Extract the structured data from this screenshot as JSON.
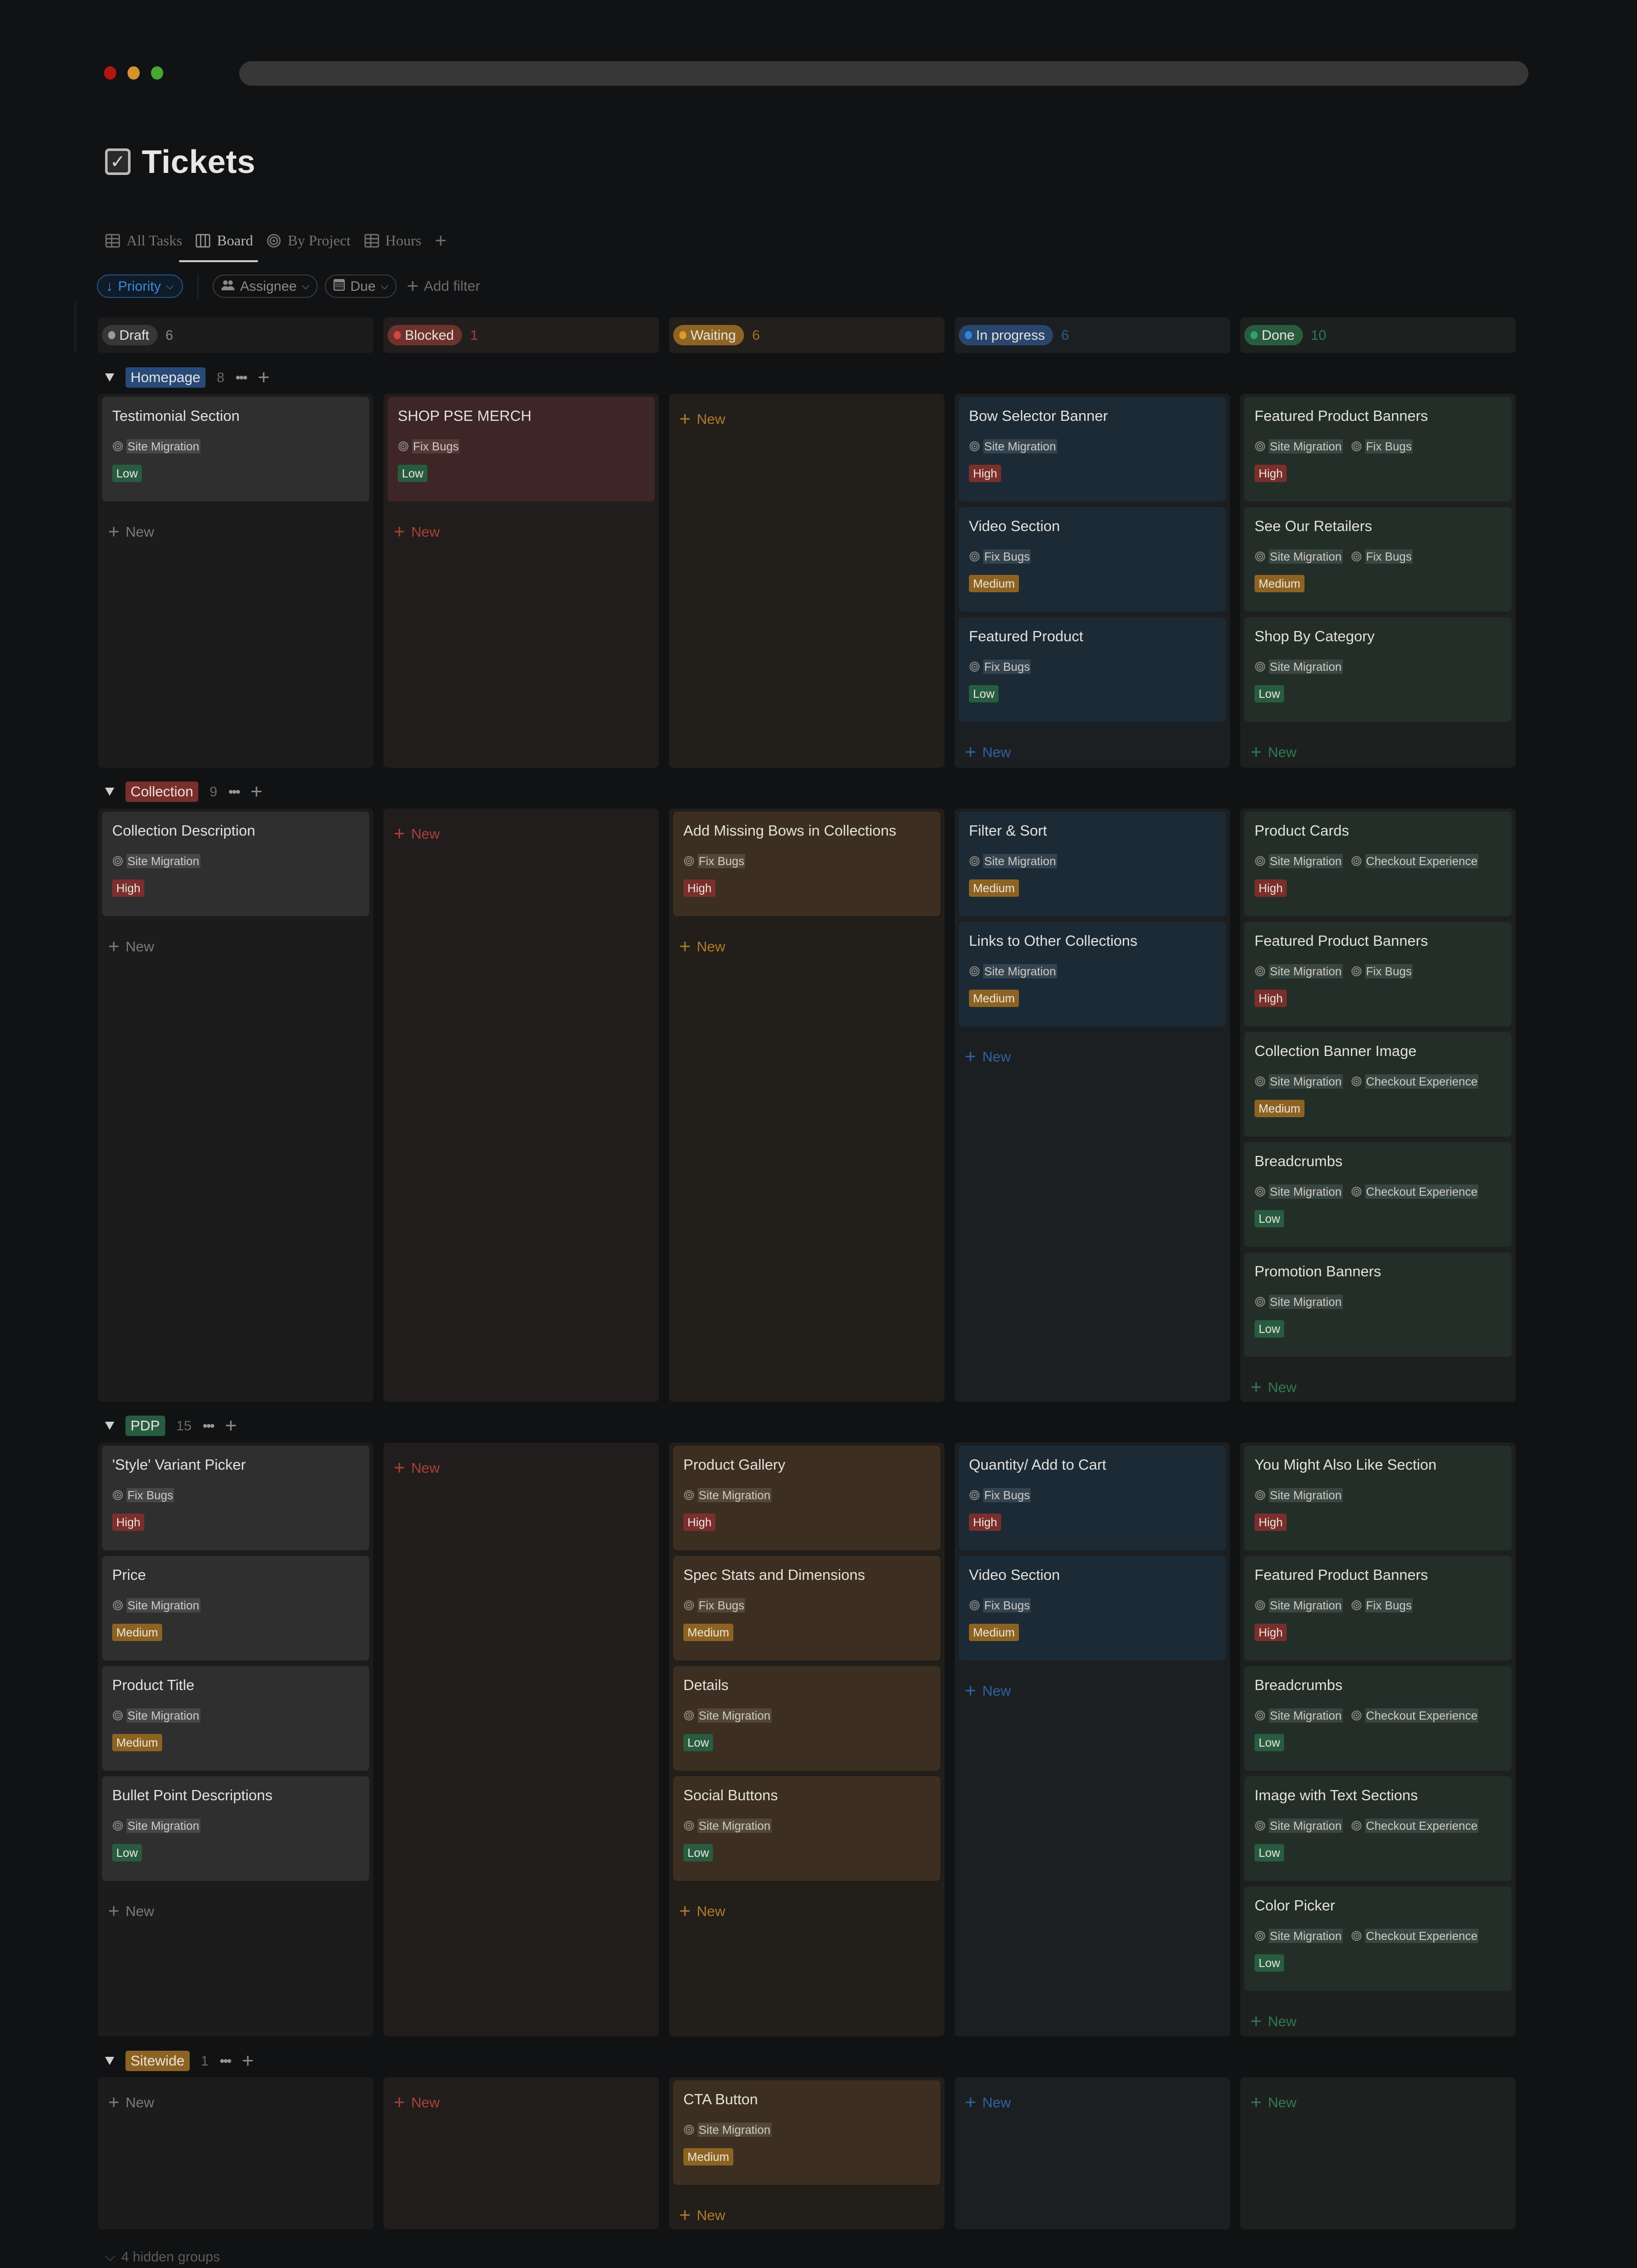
{
  "window": {
    "traffic_lights": [
      {
        "name": "close",
        "color": "#b3160f"
      },
      {
        "name": "minimize",
        "color": "#d5922f"
      },
      {
        "name": "maximize",
        "color": "#46a733"
      }
    ]
  },
  "page": {
    "title": "Tickets",
    "icon": "checkbox-icon"
  },
  "tabs": [
    {
      "label": "All Tasks",
      "icon": "table-icon",
      "active": false
    },
    {
      "label": "Board",
      "icon": "board-icon",
      "active": true
    },
    {
      "label": "By Project",
      "icon": "target-icon",
      "active": false
    },
    {
      "label": "Hours",
      "icon": "table-icon",
      "active": false
    }
  ],
  "tab_add_label": "+",
  "filters": {
    "sort": {
      "label": "Priority",
      "icon": "arrow-down-icon",
      "color": "#3b8ae0"
    },
    "assignee": {
      "label": "Assignee",
      "icon": "people-icon"
    },
    "due": {
      "label": "Due",
      "icon": "calendar-icon"
    },
    "add_filter_label": "Add filter"
  },
  "statuses": [
    {
      "key": "draft",
      "label": "Draft",
      "count": "6",
      "dot": "#9b9a97",
      "pill_bg": "#373737",
      "head_bg": "#1c1c1d",
      "lane_bg": "#1c1c1d",
      "card_bg": "#2f2f2f",
      "count_color": "#8a8884",
      "new_color": "#7d7a75",
      "tag_bg": "#474747"
    },
    {
      "key": "blocked",
      "label": "Blocked",
      "count": "1",
      "dot": "#d4463f",
      "pill_bg": "#6e322d",
      "head_bg": "#231e1e",
      "lane_bg": "#221d1d",
      "card_bg": "#3d2625",
      "count_color": "#a8403a",
      "new_color": "#a8403a",
      "tag_bg": "#553a38"
    },
    {
      "key": "waiting",
      "label": "Waiting",
      "count": "6",
      "dot": "#d99c26",
      "pill_bg": "#8e6423",
      "head_bg": "#221f1c",
      "lane_bg": "#221e1a",
      "card_bg": "#3c2f21",
      "count_color": "#a0722a",
      "new_color": "#b07c2a",
      "tag_bg": "#54473a"
    },
    {
      "key": "in_progress",
      "label": "In progress",
      "count": "6",
      "dot": "#2d84e0",
      "pill_bg": "#28466e",
      "head_bg": "#1c1f22",
      "lane_bg": "#1b1f22",
      "card_bg": "#1c2a36",
      "count_color": "#2f5a8e",
      "new_color": "#2f63a0",
      "tag_bg": "#334350"
    },
    {
      "key": "done",
      "label": "Done",
      "count": "10",
      "dot": "#2fa36a",
      "pill_bg": "#2a5b3f",
      "head_bg": "#1c201e",
      "lane_bg": "#1d201e",
      "card_bg": "#232e29",
      "count_color": "#2e7a55",
      "new_color": "#2e7a55",
      "tag_bg": "#3a4641"
    }
  ],
  "priority_colors": {
    "High": "#7a2f2c",
    "Medium": "#8d6322",
    "Low": "#285c40"
  },
  "new_label": "New",
  "groups": [
    {
      "label": "Homepage",
      "count": "8",
      "color": "#284a78",
      "lanes": {
        "draft": [
          {
            "title": "Testimonial Section",
            "tags": [
              "Site Migration"
            ],
            "priority": "Low"
          }
        ],
        "blocked": [
          {
            "title": "SHOP PSE MERCH",
            "tags": [
              "Fix Bugs"
            ],
            "priority": "Low"
          }
        ],
        "waiting": [],
        "in_progress": [
          {
            "title": "Bow Selector Banner",
            "tags": [
              "Site Migration"
            ],
            "priority": "High"
          },
          {
            "title": "Video Section",
            "tags": [
              "Fix Bugs"
            ],
            "priority": "Medium"
          },
          {
            "title": "Featured Product",
            "tags": [
              "Fix Bugs"
            ],
            "priority": "Low"
          }
        ],
        "done": [
          {
            "title": "Featured Product Banners",
            "tags": [
              "Site Migration",
              "Fix Bugs"
            ],
            "priority": "High"
          },
          {
            "title": "See Our Retailers",
            "tags": [
              "Site Migration",
              "Fix Bugs"
            ],
            "priority": "Medium"
          },
          {
            "title": "Shop By Category",
            "tags": [
              "Site Migration"
            ],
            "priority": "Low"
          }
        ]
      }
    },
    {
      "label": "Collection",
      "count": "9",
      "color": "#7a2f2c",
      "lanes": {
        "draft": [
          {
            "title": "Collection Description",
            "tags": [
              "Site Migration"
            ],
            "priority": "High"
          }
        ],
        "blocked": [],
        "waiting": [
          {
            "title": "Add Missing Bows in Collections",
            "tags": [
              "Fix Bugs"
            ],
            "priority": "High"
          }
        ],
        "in_progress": [
          {
            "title": "Filter & Sort",
            "tags": [
              "Site Migration"
            ],
            "priority": "Medium"
          },
          {
            "title": "Links to Other Collections",
            "tags": [
              "Site Migration"
            ],
            "priority": "Medium"
          }
        ],
        "done": [
          {
            "title": "Product Cards",
            "tags": [
              "Site Migration",
              "Checkout Experience"
            ],
            "priority": "High"
          },
          {
            "title": "Featured Product Banners",
            "tags": [
              "Site Migration",
              "Fix Bugs"
            ],
            "priority": "High"
          },
          {
            "title": "Collection Banner  Image",
            "tags": [
              "Site Migration",
              "Checkout Experience"
            ],
            "priority": "Medium"
          },
          {
            "title": "Breadcrumbs",
            "tags": [
              "Site Migration",
              "Checkout Experience"
            ],
            "priority": "Low"
          },
          {
            "title": "Promotion Banners",
            "tags": [
              "Site Migration"
            ],
            "priority": "Low"
          }
        ]
      }
    },
    {
      "label": "PDP",
      "count": "15",
      "color": "#285c40",
      "lanes": {
        "draft": [
          {
            "title": "'Style' Variant Picker",
            "tags": [
              "Fix Bugs"
            ],
            "priority": "High"
          },
          {
            "title": "Price",
            "tags": [
              "Site Migration"
            ],
            "priority": "Medium"
          },
          {
            "title": "Product Title",
            "tags": [
              "Site Migration"
            ],
            "priority": "Medium"
          },
          {
            "title": "Bullet Point Descriptions",
            "tags": [
              "Site Migration"
            ],
            "priority": "Low"
          }
        ],
        "blocked": [],
        "waiting": [
          {
            "title": "Product Gallery",
            "tags": [
              "Site Migration"
            ],
            "priority": "High"
          },
          {
            "title": "Spec Stats and Dimensions",
            "tags": [
              "Fix Bugs"
            ],
            "priority": "Medium"
          },
          {
            "title": "Details",
            "tags": [
              "Site Migration"
            ],
            "priority": "Low"
          },
          {
            "title": "Social Buttons",
            "tags": [
              "Site Migration"
            ],
            "priority": "Low"
          }
        ],
        "in_progress": [
          {
            "title": "Quantity/ Add to Cart",
            "tags": [
              "Fix Bugs"
            ],
            "priority": "High"
          },
          {
            "title": "Video Section",
            "tags": [
              "Fix Bugs"
            ],
            "priority": "Medium"
          }
        ],
        "done": [
          {
            "title": "You Might Also Like Section",
            "tags": [
              "Site Migration"
            ],
            "priority": "High"
          },
          {
            "title": "Featured Product Banners",
            "tags": [
              "Site Migration",
              "Fix Bugs"
            ],
            "priority": "High"
          },
          {
            "title": "Breadcrumbs",
            "tags": [
              "Site Migration",
              "Checkout Experience"
            ],
            "priority": "Low"
          },
          {
            "title": "Image with Text Sections",
            "tags": [
              "Site Migration",
              "Checkout Experience"
            ],
            "priority": "Low"
          },
          {
            "title": "Color Picker",
            "tags": [
              "Site Migration",
              "Checkout Experience"
            ],
            "priority": "Low"
          }
        ]
      }
    },
    {
      "label": "Sitewide",
      "count": "1",
      "color": "#8d6322",
      "lanes": {
        "draft": [],
        "blocked": [],
        "waiting": [
          {
            "title": "CTA Button",
            "tags": [
              "Site Migration"
            ],
            "priority": "Medium"
          }
        ],
        "in_progress": [],
        "done": []
      }
    }
  ],
  "hidden_groups_label": "4 hidden groups"
}
